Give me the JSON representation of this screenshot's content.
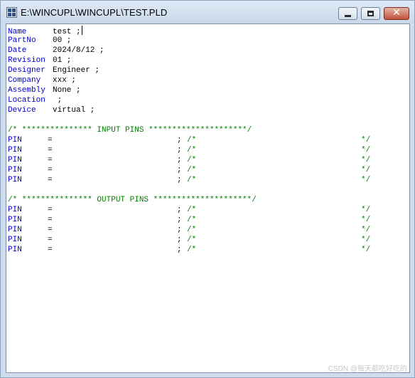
{
  "window": {
    "title": "E:\\WINCUPL\\WINCUPL\\TEST.PLD",
    "close_glyph": "✕"
  },
  "header_fields": [
    {
      "key": "Name",
      "value": "test ;"
    },
    {
      "key": "PartNo",
      "value": "00 ;"
    },
    {
      "key": "Date",
      "value": "2024/8/12 ;"
    },
    {
      "key": "Revision",
      "value": "01 ;"
    },
    {
      "key": "Designer",
      "value": "Engineer ;"
    },
    {
      "key": "Company",
      "value": "xxx ;"
    },
    {
      "key": "Assembly",
      "value": "None ;"
    },
    {
      "key": "Location",
      "value": " ;"
    },
    {
      "key": "Device",
      "value": "virtual ;"
    }
  ],
  "input_section": {
    "banner": "/* *************** INPUT PINS *********************/",
    "rows": [
      {
        "kw": "PIN",
        "eq": "=",
        "semi": ";",
        "c_open": "/*",
        "c_close": "*/"
      },
      {
        "kw": "PIN",
        "eq": "=",
        "semi": ";",
        "c_open": "/*",
        "c_close": "*/"
      },
      {
        "kw": "PIN",
        "eq": "=",
        "semi": ";",
        "c_open": "/*",
        "c_close": "*/"
      },
      {
        "kw": "PIN",
        "eq": "=",
        "semi": ";",
        "c_open": "/*",
        "c_close": "*/"
      },
      {
        "kw": "PIN",
        "eq": "=",
        "semi": ";",
        "c_open": "/*",
        "c_close": "*/"
      }
    ]
  },
  "output_section": {
    "banner": "/* *************** OUTPUT PINS *********************/",
    "rows": [
      {
        "kw": "PIN",
        "eq": "=",
        "semi": ";",
        "c_open": "/*",
        "c_close": "*/"
      },
      {
        "kw": "PIN",
        "eq": "=",
        "semi": ";",
        "c_open": "/*",
        "c_close": "*/"
      },
      {
        "kw": "PIN",
        "eq": "=",
        "semi": ";",
        "c_open": "/*",
        "c_close": "*/"
      },
      {
        "kw": "PIN",
        "eq": "=",
        "semi": ";",
        "c_open": "/*",
        "c_close": "*/"
      },
      {
        "kw": "PIN",
        "eq": "=",
        "semi": ";",
        "c_open": "/*",
        "c_close": "*/"
      }
    ]
  },
  "watermark": "CSDN @每天都吃好吃的",
  "colors": {
    "keyword": "#0000cc",
    "comment": "#008000",
    "text": "#000000"
  }
}
